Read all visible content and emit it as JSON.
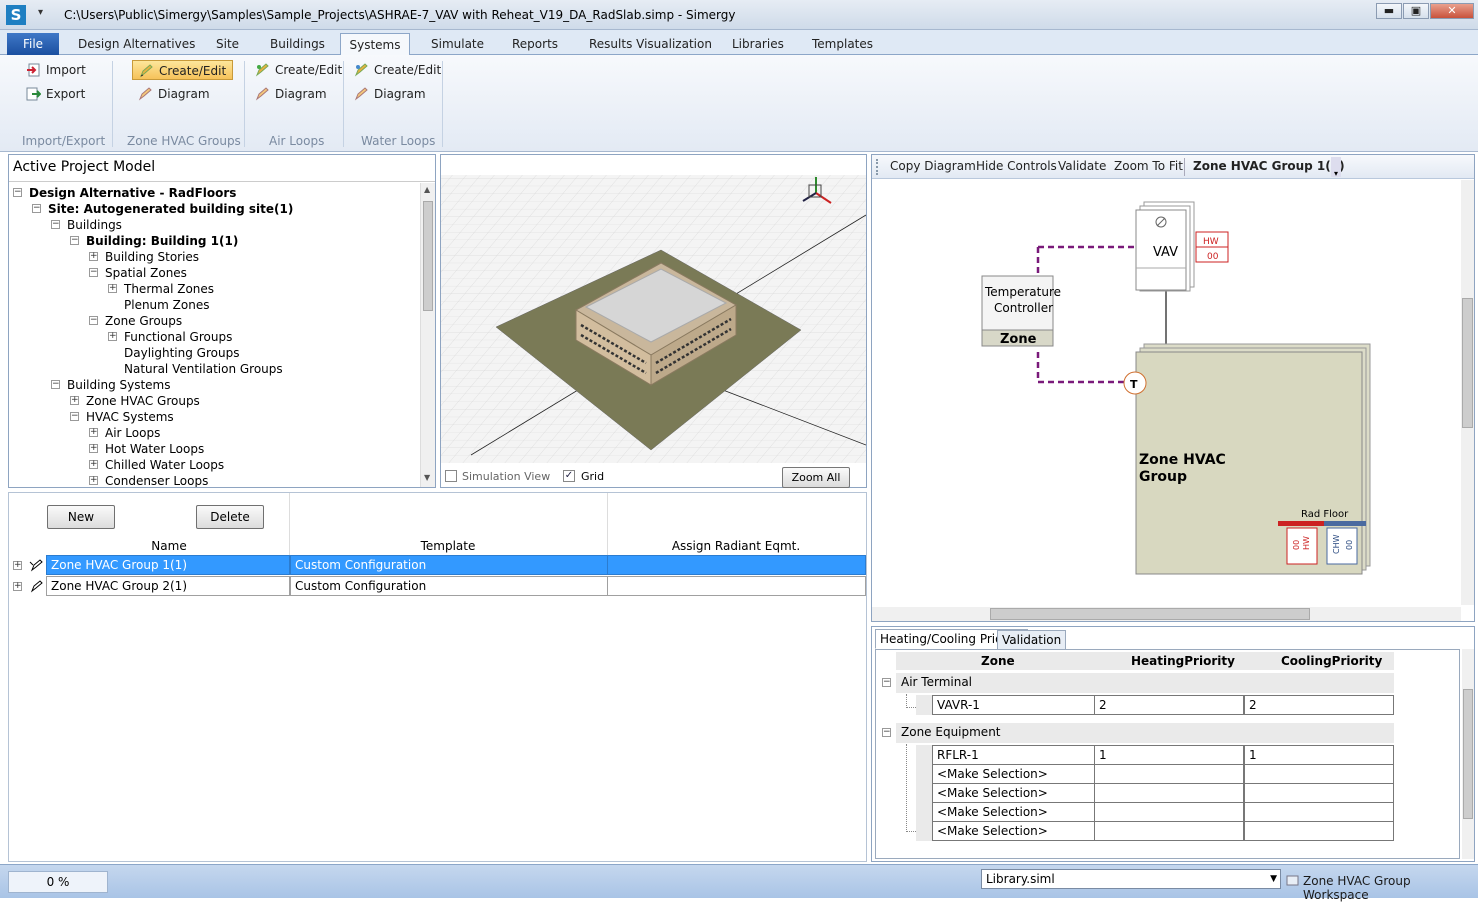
{
  "window": {
    "title": "C:\\Users\\Public\\Simergy\\Samples\\Sample_Projects\\ASHRAE-7_VAV with Reheat_V19_DA_RadSlab.simp - Simergy",
    "logo": "S",
    "qat": "▾",
    "min": "▬",
    "max": "▣",
    "close": "✕"
  },
  "ribbon_tabs": [
    "File",
    "Design Alternatives",
    "Site",
    "Buildings",
    "Systems",
    "Simulate",
    "Reports",
    "Results Visualization",
    "Libraries",
    "Templates"
  ],
  "help": "?",
  "help_arrow": "▾",
  "ribbon": {
    "import_export": {
      "import": "Import",
      "export": "Export",
      "label": "Import/Export"
    },
    "zone_hvac": {
      "create": "Create/Edit",
      "diagram": "Diagram",
      "label": "Zone HVAC Groups"
    },
    "air_loops": {
      "create": "Create/Edit",
      "diagram": "Diagram",
      "label": "Air Loops"
    },
    "water_loops": {
      "create": "Create/Edit",
      "diagram": "Diagram",
      "label": "Water Loops"
    }
  },
  "tree": {
    "title": "Active Project Model",
    "nodes": [
      {
        "label": "Design Alternative - RadFloors",
        "bold": true,
        "level": 0,
        "exp": "−"
      },
      {
        "label": "Site: Autogenerated building site(1)",
        "bold": true,
        "level": 1,
        "exp": "−"
      },
      {
        "label": "Buildings",
        "bold": false,
        "level": 2,
        "exp": "−"
      },
      {
        "label": "Building: Building  1(1)",
        "bold": true,
        "level": 3,
        "exp": "−"
      },
      {
        "label": "Building Stories",
        "bold": false,
        "level": 4,
        "exp": "+"
      },
      {
        "label": "Spatial Zones",
        "bold": false,
        "level": 4,
        "exp": "−"
      },
      {
        "label": "Thermal Zones",
        "bold": false,
        "level": 5,
        "exp": "+"
      },
      {
        "label": "Plenum Zones",
        "bold": false,
        "level": 5,
        "exp": ""
      },
      {
        "label": "Zone Groups",
        "bold": false,
        "level": 4,
        "exp": "−"
      },
      {
        "label": "Functional Groups",
        "bold": false,
        "level": 5,
        "exp": "+"
      },
      {
        "label": "Daylighting Groups",
        "bold": false,
        "level": 5,
        "exp": ""
      },
      {
        "label": "Natural Ventilation Groups",
        "bold": false,
        "level": 5,
        "exp": ""
      },
      {
        "label": "Building Systems",
        "bold": false,
        "level": 2,
        "exp": "−"
      },
      {
        "label": "Zone HVAC Groups",
        "bold": false,
        "level": 3,
        "exp": "+"
      },
      {
        "label": "HVAC Systems",
        "bold": false,
        "level": 3,
        "exp": "−"
      },
      {
        "label": "Air Loops",
        "bold": false,
        "level": 4,
        "exp": "+"
      },
      {
        "label": "Hot Water Loops",
        "bold": false,
        "level": 4,
        "exp": "+"
      },
      {
        "label": "Chilled Water Loops",
        "bold": false,
        "level": 4,
        "exp": "+"
      },
      {
        "label": "Condenser Loops",
        "bold": false,
        "level": 4,
        "exp": "+"
      }
    ]
  },
  "viewport": {
    "simulation_view": "Simulation View",
    "grid": "Grid",
    "grid_checked": "✓",
    "zoom_all": "Zoom All"
  },
  "groups_grid": {
    "new": "New",
    "delete": "Delete",
    "headers": [
      "Name",
      "Template",
      "Assign Radiant Eqmt."
    ],
    "rows": [
      {
        "name": "Zone HVAC Group  1(1)",
        "template": "Custom Configuration",
        "radiant": ""
      },
      {
        "name": "Zone HVAC Group  2(1)",
        "template": "Custom Configuration",
        "radiant": ""
      }
    ]
  },
  "diagram": {
    "toolbar": [
      "Copy Diagram",
      "Hide Controls",
      "Validate",
      "Zoom To Fit"
    ],
    "active_group": "Zone HVAC Group  1(1)",
    "vav": "VAV",
    "hw": "HW",
    "hw_val": "00",
    "tc_line1": "Temperature",
    "tc_line2": "Controller",
    "zone": "Zone",
    "t": "T",
    "group_line1": "Zone HVAC",
    "group_line2": "Group",
    "rad_floor": "Rad Floor",
    "rf_hw": "HW",
    "rf_00": "00",
    "rf_chw": "CHW",
    "rf_00b": "00"
  },
  "priority": {
    "tabs": [
      "Heating/Cooling Priority",
      "Validation"
    ],
    "headers": [
      "Zone",
      "HeatingPriority",
      "CoolingPriority"
    ],
    "air_terminal": "Air Terminal",
    "zone_equipment": "Zone Equipment",
    "air_rows": [
      {
        "zone": "VAVR-1",
        "heat": "2",
        "cool": "2"
      }
    ],
    "eq_rows": [
      {
        "zone": "RFLR-1",
        "heat": "1",
        "cool": "1"
      },
      {
        "zone": "<Make Selection>",
        "heat": "",
        "cool": ""
      },
      {
        "zone": "<Make Selection>",
        "heat": "",
        "cool": ""
      },
      {
        "zone": "<Make Selection>",
        "heat": "",
        "cool": ""
      },
      {
        "zone": "<Make Selection>",
        "heat": "",
        "cool": ""
      }
    ]
  },
  "status": {
    "progress": "0 %",
    "library": "Library.siml",
    "workspace": "Zone HVAC Group Workspace",
    "dropdown_arrow": "▼"
  }
}
